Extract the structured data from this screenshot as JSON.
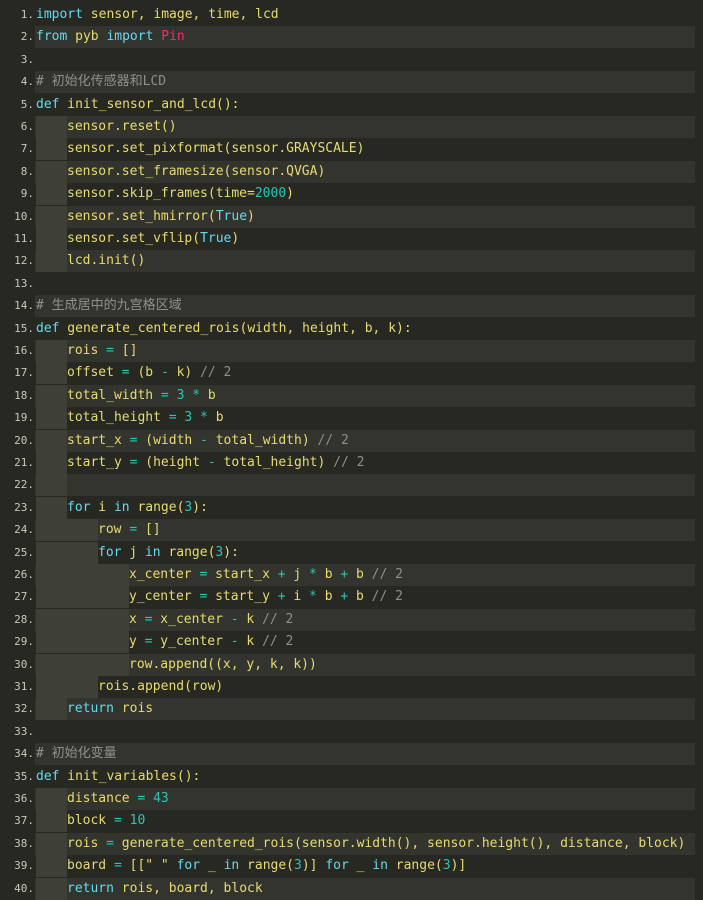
{
  "editor": {
    "lines": [
      {
        "n": "1.",
        "indent": 0,
        "tokens": [
          [
            "kw",
            "import"
          ],
          [
            "id",
            " sensor, image, time, lcd"
          ]
        ]
      },
      {
        "n": "2.",
        "indent": 0,
        "tokens": [
          [
            "kw",
            "from"
          ],
          [
            "id",
            " pyb "
          ],
          [
            "kw",
            "import"
          ],
          [
            "pin",
            " Pin"
          ]
        ]
      },
      {
        "n": "3.",
        "indent": 0,
        "tokens": []
      },
      {
        "n": "4.",
        "indent": 0,
        "tokens": [
          [
            "cmt",
            "# 初始化传感器和LCD"
          ]
        ]
      },
      {
        "n": "5.",
        "indent": 0,
        "tokens": [
          [
            "kw",
            "def"
          ],
          [
            "id",
            " init_sensor_and_lcd():"
          ]
        ]
      },
      {
        "n": "6.",
        "indent": 1,
        "tokens": [
          [
            "id",
            "sensor.reset()"
          ]
        ]
      },
      {
        "n": "7.",
        "indent": 1,
        "tokens": [
          [
            "id",
            "sensor.set_pixformat(sensor.GRAYSCALE)"
          ]
        ]
      },
      {
        "n": "8.",
        "indent": 1,
        "tokens": [
          [
            "id",
            "sensor.set_framesize(sensor.QVGA)"
          ]
        ]
      },
      {
        "n": "9.",
        "indent": 1,
        "tokens": [
          [
            "id",
            "sensor.skip_frames(time="
          ],
          [
            "num",
            "2000"
          ],
          [
            "id",
            ")"
          ]
        ]
      },
      {
        "n": "10.",
        "indent": 1,
        "tokens": [
          [
            "id",
            "sensor.set_hmirror("
          ],
          [
            "bool",
            "True"
          ],
          [
            "id",
            ")"
          ]
        ]
      },
      {
        "n": "11.",
        "indent": 1,
        "tokens": [
          [
            "id",
            "sensor.set_vflip("
          ],
          [
            "bool",
            "True"
          ],
          [
            "id",
            ")"
          ]
        ]
      },
      {
        "n": "12.",
        "indent": 1,
        "tokens": [
          [
            "id",
            "lcd.init()"
          ]
        ]
      },
      {
        "n": "13.",
        "indent": 0,
        "tokens": []
      },
      {
        "n": "14.",
        "indent": 0,
        "tokens": [
          [
            "cmt",
            "# 生成居中的九宫格区域"
          ]
        ]
      },
      {
        "n": "15.",
        "indent": 0,
        "tokens": [
          [
            "kw",
            "def"
          ],
          [
            "id",
            " generate_centered_rois(width, height, b, k):"
          ]
        ]
      },
      {
        "n": "16.",
        "indent": 1,
        "tokens": [
          [
            "id",
            "rois "
          ],
          [
            "op",
            "="
          ],
          [
            "id",
            " []"
          ]
        ]
      },
      {
        "n": "17.",
        "indent": 1,
        "tokens": [
          [
            "id",
            "offset "
          ],
          [
            "op",
            "="
          ],
          [
            "id",
            " (b "
          ],
          [
            "op",
            "-"
          ],
          [
            "id",
            " k) "
          ],
          [
            "cmt",
            "// 2"
          ]
        ]
      },
      {
        "n": "18.",
        "indent": 1,
        "tokens": [
          [
            "id",
            "total_width "
          ],
          [
            "op",
            "="
          ],
          [
            "num",
            " 3"
          ],
          [
            "op",
            " *"
          ],
          [
            "id",
            " b"
          ]
        ]
      },
      {
        "n": "19.",
        "indent": 1,
        "tokens": [
          [
            "id",
            "total_height "
          ],
          [
            "op",
            "="
          ],
          [
            "num",
            " 3"
          ],
          [
            "op",
            " *"
          ],
          [
            "id",
            " b"
          ]
        ]
      },
      {
        "n": "20.",
        "indent": 1,
        "tokens": [
          [
            "id",
            "start_x "
          ],
          [
            "op",
            "="
          ],
          [
            "id",
            " (width "
          ],
          [
            "op",
            "-"
          ],
          [
            "id",
            " total_width) "
          ],
          [
            "cmt",
            "// 2"
          ]
        ]
      },
      {
        "n": "21.",
        "indent": 1,
        "tokens": [
          [
            "id",
            "start_y "
          ],
          [
            "op",
            "="
          ],
          [
            "id",
            " (height "
          ],
          [
            "op",
            "-"
          ],
          [
            "id",
            " total_height) "
          ],
          [
            "cmt",
            "// 2"
          ]
        ]
      },
      {
        "n": "22.",
        "indent": 1,
        "tokens": []
      },
      {
        "n": "23.",
        "indent": 1,
        "tokens": [
          [
            "kw",
            "for"
          ],
          [
            "id",
            " i "
          ],
          [
            "kw",
            "in"
          ],
          [
            "id",
            " range("
          ],
          [
            "num",
            "3"
          ],
          [
            "id",
            "):"
          ]
        ]
      },
      {
        "n": "24.",
        "indent": 2,
        "tokens": [
          [
            "id",
            "row "
          ],
          [
            "op",
            "="
          ],
          [
            "id",
            " []"
          ]
        ]
      },
      {
        "n": "25.",
        "indent": 2,
        "tokens": [
          [
            "kw",
            "for"
          ],
          [
            "id",
            " j "
          ],
          [
            "kw",
            "in"
          ],
          [
            "id",
            " range("
          ],
          [
            "num",
            "3"
          ],
          [
            "id",
            "):"
          ]
        ]
      },
      {
        "n": "26.",
        "indent": 3,
        "tokens": [
          [
            "id",
            "x_center "
          ],
          [
            "op",
            "="
          ],
          [
            "id",
            " start_x "
          ],
          [
            "op",
            "+"
          ],
          [
            "id",
            " j "
          ],
          [
            "op",
            "*"
          ],
          [
            "id",
            " b "
          ],
          [
            "op",
            "+"
          ],
          [
            "id",
            " b "
          ],
          [
            "cmt",
            "// 2"
          ]
        ]
      },
      {
        "n": "27.",
        "indent": 3,
        "tokens": [
          [
            "id",
            "y_center "
          ],
          [
            "op",
            "="
          ],
          [
            "id",
            " start_y "
          ],
          [
            "op",
            "+"
          ],
          [
            "id",
            " i "
          ],
          [
            "op",
            "*"
          ],
          [
            "id",
            " b "
          ],
          [
            "op",
            "+"
          ],
          [
            "id",
            " b "
          ],
          [
            "cmt",
            "// 2"
          ]
        ]
      },
      {
        "n": "28.",
        "indent": 3,
        "tokens": [
          [
            "id",
            "x "
          ],
          [
            "op",
            "="
          ],
          [
            "id",
            " x_center "
          ],
          [
            "op",
            "-"
          ],
          [
            "id",
            " k "
          ],
          [
            "cmt",
            "// 2"
          ]
        ]
      },
      {
        "n": "29.",
        "indent": 3,
        "tokens": [
          [
            "id",
            "y "
          ],
          [
            "op",
            "="
          ],
          [
            "id",
            " y_center "
          ],
          [
            "op",
            "-"
          ],
          [
            "id",
            " k "
          ],
          [
            "cmt",
            "// 2"
          ]
        ]
      },
      {
        "n": "30.",
        "indent": 3,
        "tokens": [
          [
            "id",
            "row.append((x, y, k, k))"
          ]
        ]
      },
      {
        "n": "31.",
        "indent": 2,
        "tokens": [
          [
            "id",
            "rois.append(row)"
          ]
        ]
      },
      {
        "n": "32.",
        "indent": 1,
        "tokens": [
          [
            "kw",
            "return"
          ],
          [
            "id",
            " rois"
          ]
        ]
      },
      {
        "n": "33.",
        "indent": 0,
        "tokens": []
      },
      {
        "n": "34.",
        "indent": 0,
        "tokens": [
          [
            "cmt",
            "# 初始化变量"
          ]
        ]
      },
      {
        "n": "35.",
        "indent": 0,
        "tokens": [
          [
            "kw",
            "def"
          ],
          [
            "id",
            " init_variables():"
          ]
        ]
      },
      {
        "n": "36.",
        "indent": 1,
        "tokens": [
          [
            "id",
            "distance "
          ],
          [
            "op",
            "="
          ],
          [
            "num",
            " 43"
          ]
        ]
      },
      {
        "n": "37.",
        "indent": 1,
        "tokens": [
          [
            "id",
            "block "
          ],
          [
            "op",
            "="
          ],
          [
            "num",
            " 10"
          ]
        ]
      },
      {
        "n": "38.",
        "indent": 1,
        "tokens": [
          [
            "id",
            "rois "
          ],
          [
            "op",
            "="
          ],
          [
            "id",
            " generate_centered_rois(sensor.width(), sensor.height(), distance, block)"
          ]
        ]
      },
      {
        "n": "39.",
        "indent": 1,
        "tokens": [
          [
            "id",
            "board "
          ],
          [
            "op",
            "="
          ],
          [
            "id",
            " [[\" \" "
          ],
          [
            "kw",
            "for"
          ],
          [
            "id",
            " _ "
          ],
          [
            "kw",
            "in"
          ],
          [
            "id",
            " range("
          ],
          [
            "num",
            "3"
          ],
          [
            "id",
            ")] "
          ],
          [
            "kw",
            "for"
          ],
          [
            "id",
            " _ "
          ],
          [
            "kw",
            "in"
          ],
          [
            "id",
            " range("
          ],
          [
            "num",
            "3"
          ],
          [
            "id",
            ")]"
          ]
        ]
      },
      {
        "n": "40.",
        "indent": 1,
        "tokens": [
          [
            "kw",
            "return"
          ],
          [
            "id",
            " rois, board, block"
          ]
        ]
      }
    ]
  }
}
